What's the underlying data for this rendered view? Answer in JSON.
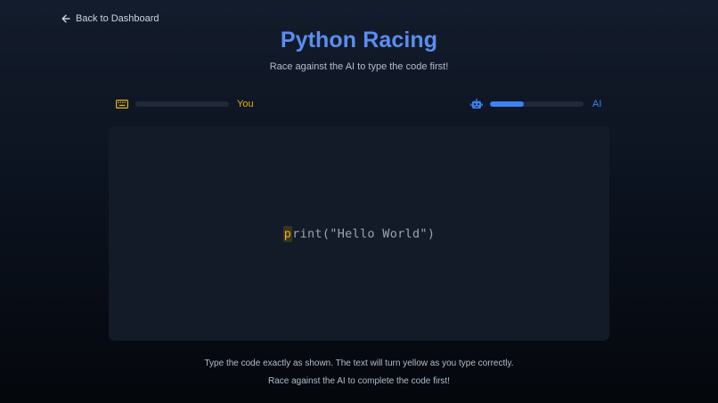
{
  "nav": {
    "back_label": "Back to Dashboard",
    "back_icon": "arrow-left-icon"
  },
  "header": {
    "title": "Python Racing",
    "subtitle": "Race against the AI to type the code first!"
  },
  "race": {
    "you": {
      "label": "You",
      "icon": "keyboard-icon",
      "progress": 0,
      "color": "#eab308"
    },
    "ai": {
      "label": "AI",
      "icon": "robot-icon",
      "progress": 0.36,
      "color": "#3b82f6"
    }
  },
  "code": {
    "typed": "",
    "current_char": "p",
    "remaining": "rint(\"Hello World\")"
  },
  "instructions": {
    "line1": "Type the code exactly as shown. The text will turn yellow as you type correctly.",
    "line2": "Race against the AI to complete the code first!"
  },
  "colors": {
    "accent": "#5b8def",
    "you": "#eab308",
    "ai": "#3b82f6",
    "panel": "#131b29"
  }
}
